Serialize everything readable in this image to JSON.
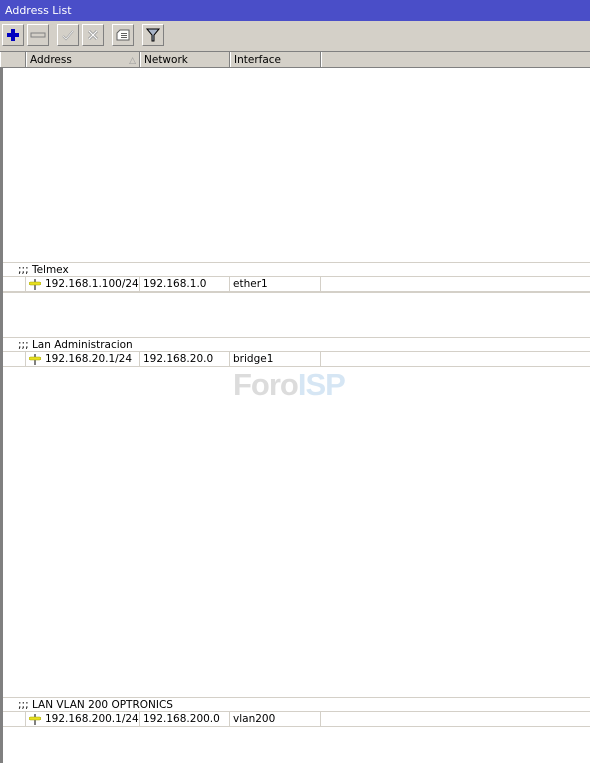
{
  "window": {
    "title": "Address List"
  },
  "toolbar": {
    "buttons": [
      {
        "name": "add",
        "icon": "plus-icon",
        "enabled": true
      },
      {
        "name": "remove",
        "icon": "minus-icon",
        "enabled": true
      },
      {
        "name": "enable",
        "icon": "check-icon",
        "enabled": false
      },
      {
        "name": "disable",
        "icon": "x-icon",
        "enabled": false
      },
      {
        "name": "comment",
        "icon": "comment-icon",
        "enabled": true
      },
      {
        "name": "filter",
        "icon": "filter-icon",
        "enabled": true
      }
    ]
  },
  "table": {
    "columns": [
      {
        "label": ""
      },
      {
        "label": "Address",
        "sorted": "ascending"
      },
      {
        "label": "Network"
      },
      {
        "label": "Interface"
      },
      {
        "label": ""
      }
    ],
    "entries": [
      {
        "comment": ";;; Telmex",
        "address": "192.168.1.100/24",
        "network": "192.168.1.0",
        "interface": "ether1",
        "icon": "address-plus-icon"
      },
      {
        "comment": ";;; Lan Administracion",
        "address": "192.168.20.1/24",
        "network": "192.168.20.0",
        "interface": "bridge1",
        "icon": "address-plus-icon"
      },
      {
        "comment": ";;; LAN VLAN 200 OPTRONICS",
        "address": "192.168.200.1/24",
        "network": "192.168.200.0",
        "interface": "vlan200",
        "icon": "address-plus-icon"
      }
    ]
  },
  "watermark": {
    "part1": "Foro",
    "part2": "ISP"
  },
  "colors": {
    "titlebar": "#4a4ec8",
    "chrome": "#d4d0c8",
    "add_icon": "#0000c0",
    "address_icon": "#e8e020"
  }
}
